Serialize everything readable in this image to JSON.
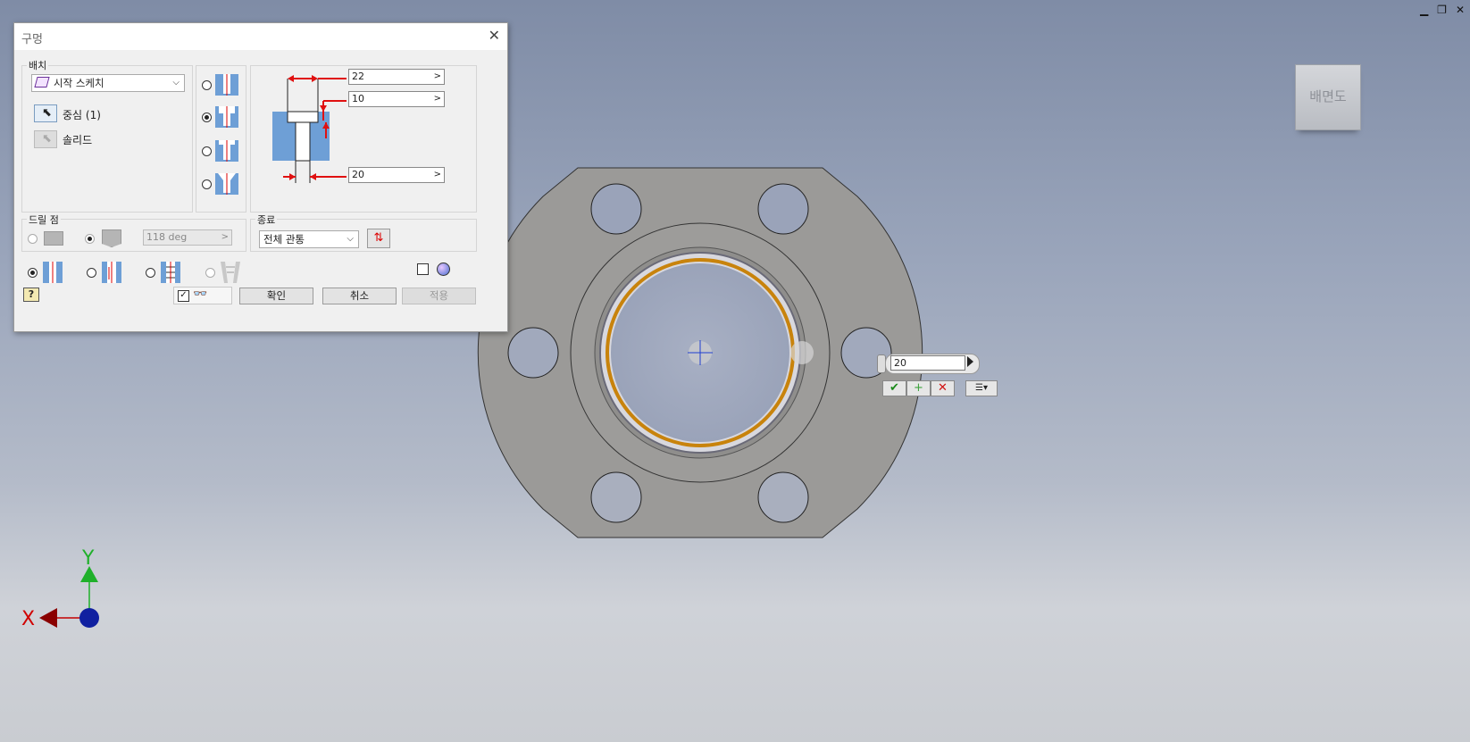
{
  "window": {
    "minimize": "▁",
    "restore": "❐",
    "close": "✕"
  },
  "dialog": {
    "title": "구멍",
    "placement": {
      "label": "배치",
      "type_value": "시작 스케치",
      "center_label": "중심 (1)",
      "solid_label": "솔리드"
    },
    "hole_type": {
      "selected": 2
    },
    "dimensions": {
      "counterbore_diameter": "22",
      "counterbore_depth": "10",
      "hole_diameter": "20"
    },
    "drill_point": {
      "label": "드릴 점",
      "angle": "118 deg"
    },
    "termination": {
      "label": "종료",
      "value": "전체 관통"
    },
    "buttons": {
      "ok": "확인",
      "cancel": "취소",
      "apply": "적용"
    },
    "preview_checked": true
  },
  "viewcube": {
    "label": "배면도"
  },
  "mini_toolbar": {
    "value": "20"
  },
  "triad": {
    "x_label": "X",
    "y_label": "Y"
  },
  "colors": {
    "accent_red": "#e01010",
    "part_gray": "#9b9a98",
    "axis_green": "#1fb02a",
    "axis_red": "#c40000",
    "axis_blue": "#1020a0",
    "ring_orange": "#c8830c"
  }
}
